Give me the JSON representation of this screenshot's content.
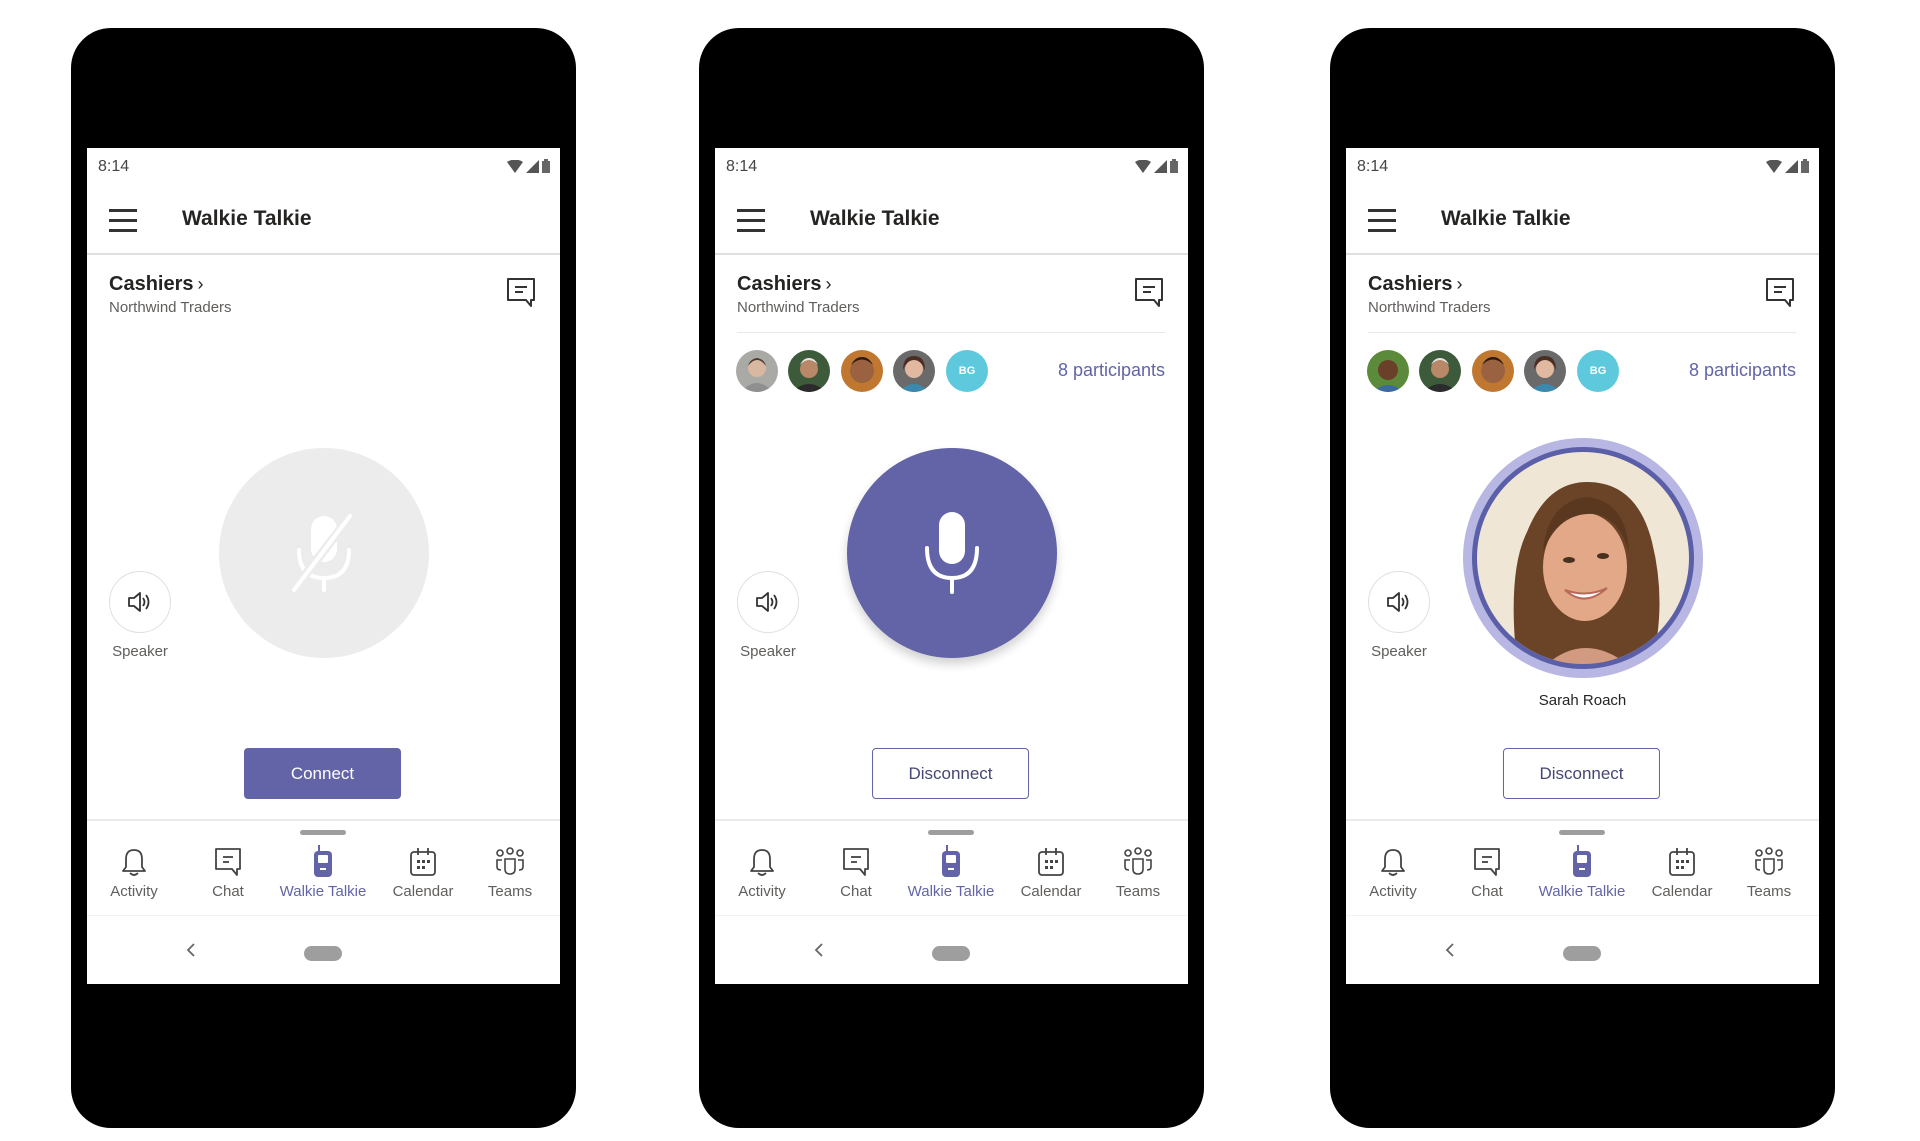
{
  "accent_color": "#6264A7",
  "phones": [
    {
      "status": {
        "time": "8:14"
      },
      "app_title": "Walkie Talkie",
      "channel": {
        "name": "Cashiers",
        "team": "Northwind Traders"
      },
      "state": "disconnected",
      "speaker_label": "Speaker",
      "action_button": "Connect",
      "tabs": [
        "Activity",
        "Chat",
        "Walkie Talkie",
        "Calendar",
        "Teams"
      ],
      "active_tab": "Walkie Talkie"
    },
    {
      "status": {
        "time": "8:14"
      },
      "app_title": "Walkie Talkie",
      "channel": {
        "name": "Cashiers",
        "team": "Northwind Traders"
      },
      "state": "connected",
      "participants": {
        "initials_avatar": "BG",
        "count_label": "8 participants"
      },
      "speaker_label": "Speaker",
      "action_button": "Disconnect",
      "tabs": [
        "Activity",
        "Chat",
        "Walkie Talkie",
        "Calendar",
        "Teams"
      ],
      "active_tab": "Walkie Talkie"
    },
    {
      "status": {
        "time": "8:14"
      },
      "app_title": "Walkie Talkie",
      "channel": {
        "name": "Cashiers",
        "team": "Northwind Traders"
      },
      "state": "receiving",
      "participants": {
        "initials_avatar": "BG",
        "count_label": "8 participants"
      },
      "active_speaker": "Sarah Roach",
      "speaker_label": "Speaker",
      "action_button": "Disconnect",
      "tabs": [
        "Activity",
        "Chat",
        "Walkie Talkie",
        "Calendar",
        "Teams"
      ],
      "active_tab": "Walkie Talkie"
    }
  ]
}
